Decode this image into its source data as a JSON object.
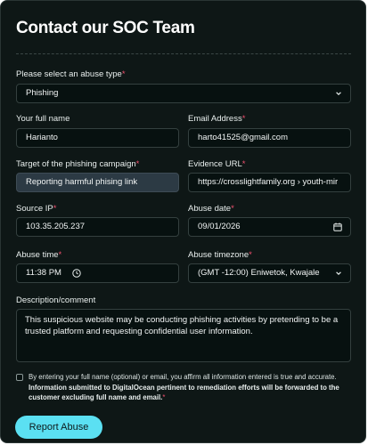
{
  "page": {
    "title": "Contact our SOC Team"
  },
  "form": {
    "abuse_type": {
      "label": "Please select an abuse type",
      "required_mark": "*",
      "value": "Phishing"
    },
    "full_name": {
      "label": "Your full name",
      "value": "Harianto"
    },
    "email": {
      "label": "Email Address",
      "required_mark": "*",
      "value": "harto41525@gmail.com"
    },
    "target": {
      "label": "Target of the phishing campaign",
      "required_mark": "*",
      "value": "Reporting harmful phising link"
    },
    "evidence_url": {
      "label": "Evidence URL",
      "required_mark": "*",
      "value": "https://crosslightfamily.org › youth-mir"
    },
    "source_ip": {
      "label": "Source IP",
      "required_mark": "*",
      "value": "103.35.205.237"
    },
    "abuse_date": {
      "label": "Abuse date",
      "required_mark": "*",
      "value": "09/01/2026"
    },
    "abuse_time": {
      "label": "Abuse time",
      "required_mark": "*",
      "value": "11:38 PM"
    },
    "abuse_timezone": {
      "label": "Abuse timezone",
      "required_mark": "*",
      "value": "(GMT -12:00) Eniwetok, Kwajale"
    },
    "description": {
      "label": "Description/comment",
      "value": "This suspicious website may be conducting phishing activities by pretending to be a trusted platform and requesting confidential user information."
    },
    "consent": {
      "checked": false,
      "text_regular": "By entering your full name (optional) or email, you affirm all information entered is true and accurate.",
      "text_bold": "Information submitted to DigitalOcean pertinent to remediation efforts will be forwarded to the customer excluding full name and email.",
      "required_mark": "*"
    },
    "submit_label": "Report Abuse"
  },
  "colors": {
    "background": "#0e1716",
    "input_background": "#071110",
    "highlighted_input": "#2c3a44",
    "required_mark": "#f0506e",
    "submit_button": "#5be0f2"
  },
  "icons": {
    "select_chevron": "chevron-down-icon",
    "date_picker": "calendar-icon",
    "time_picker": "clock-icon"
  }
}
